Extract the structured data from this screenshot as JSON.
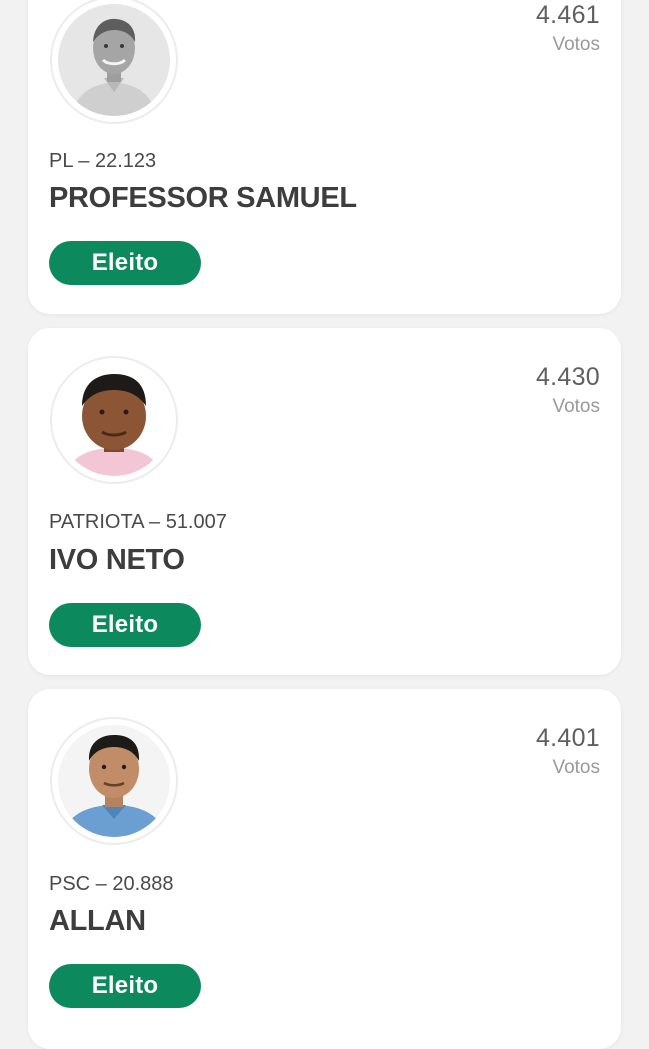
{
  "candidates": [
    {
      "party_number": "PL – 22.123",
      "name": "PROFESSOR SAMUEL",
      "votes": "4.461",
      "votes_label": "Votos",
      "status": "Eleito"
    },
    {
      "party_number": "PATRIOTA – 51.007",
      "name": "IVO NETO",
      "votes": "4.430",
      "votes_label": "Votos",
      "status": "Eleito"
    },
    {
      "party_number": "PSC – 20.888",
      "name": "ALLAN",
      "votes": "4.401",
      "votes_label": "Votos",
      "status": "Eleito"
    }
  ],
  "colors": {
    "status_elected": "#0c8a5d",
    "background": "#f2f2f2",
    "card": "#ffffff"
  }
}
